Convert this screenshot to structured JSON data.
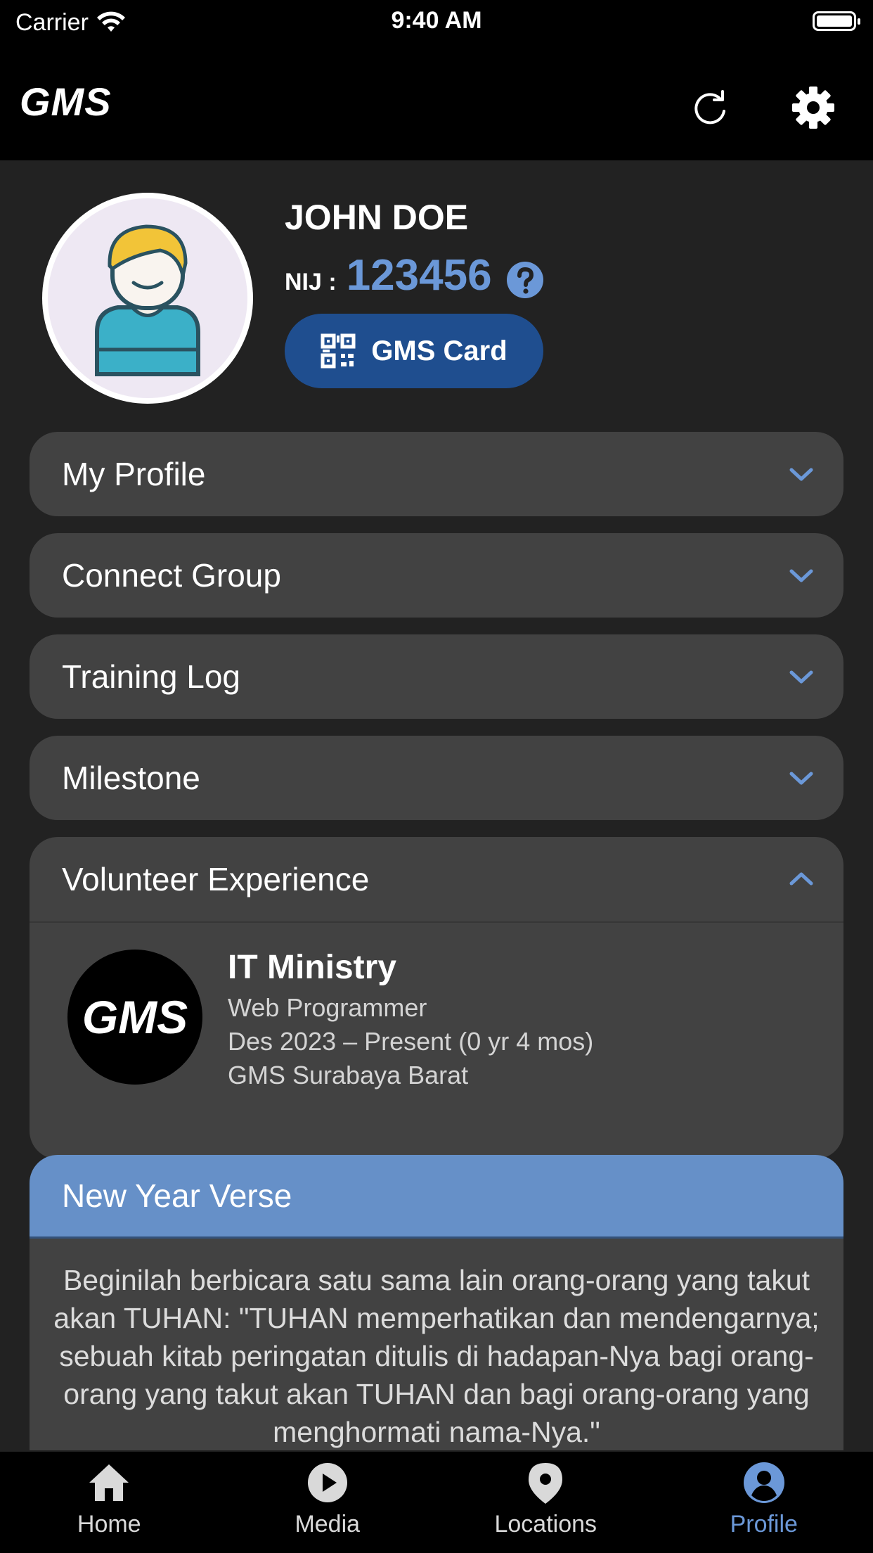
{
  "status_bar": {
    "carrier": "Carrier",
    "time": "9:40 AM"
  },
  "header": {
    "logo": "GMS",
    "refresh_icon": "refresh-icon",
    "settings_icon": "gear-icon"
  },
  "profile": {
    "name": "JOHN DOE",
    "nij_label": "NIJ :",
    "nij_value": "123456",
    "card_button": "GMS Card"
  },
  "sections": [
    {
      "title": "My Profile",
      "expanded": false
    },
    {
      "title": "Connect Group",
      "expanded": false
    },
    {
      "title": "Training Log",
      "expanded": false
    },
    {
      "title": "Milestone",
      "expanded": false
    },
    {
      "title": "Volunteer Experience",
      "expanded": true
    }
  ],
  "volunteer": {
    "logo_text": "GMS",
    "ministry": "IT Ministry",
    "role": "Web Programmer",
    "period": "Des 2023 – Present (0 yr 4 mos)",
    "location": "GMS Surabaya Barat"
  },
  "verse": {
    "title": "New Year Verse",
    "text": "Beginilah berbicara satu sama lain orang-orang yang takut akan TUHAN: \"TUHAN memperhatikan dan mendengarnya; sebuah kitab peringatan ditulis di hadapan-Nya bagi orang-orang yang takut akan TUHAN dan bagi orang-orang yang menghormati nama-Nya.\""
  },
  "tabs": [
    {
      "label": "Home",
      "icon": "home-icon",
      "active": false
    },
    {
      "label": "Media",
      "icon": "play-icon",
      "active": false
    },
    {
      "label": "Locations",
      "icon": "location-pin-icon",
      "active": false
    },
    {
      "label": "Profile",
      "icon": "user-circle-icon",
      "active": true
    }
  ],
  "colors": {
    "accent": "#6b98d8",
    "card_button": "#1f4e8f",
    "verse_header": "#6690c8",
    "panel": "#424242",
    "background": "#222222"
  }
}
